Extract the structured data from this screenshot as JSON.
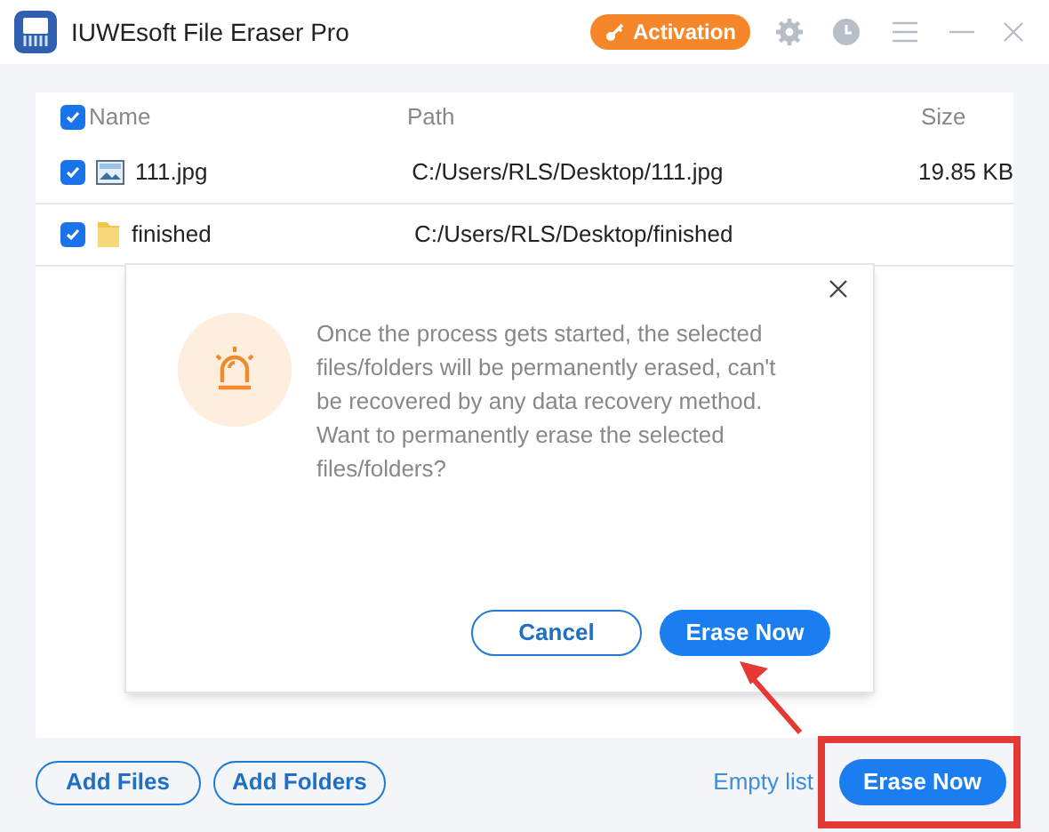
{
  "window": {
    "title": "IUWEsoft File Eraser Pro",
    "activation": "Activation"
  },
  "table": {
    "select_all_checked": true,
    "columns": [
      "Name",
      "Path",
      "Size"
    ],
    "rows": [
      {
        "kind": "image",
        "name": "111.jpg",
        "path": "C:/Users/RLS/Desktop/111.jpg",
        "size": "19.85 KB",
        "checked": true
      },
      {
        "kind": "folder",
        "name": "finished",
        "path": "C:/Users/RLS/Desktop/finished",
        "size": "",
        "checked": true
      }
    ]
  },
  "dialog": {
    "message": "Once the process gets started, the selected files/folders will be permanently erased, can't be recovered by any data recovery method. Want to permanently erase the selected files/folders?",
    "cancel": "Cancel",
    "confirm": "Erase Now"
  },
  "footer": {
    "add_files": "Add Files",
    "add_folders": "Add Folders",
    "empty_list": "Empty list",
    "erase": "Erase Now"
  }
}
